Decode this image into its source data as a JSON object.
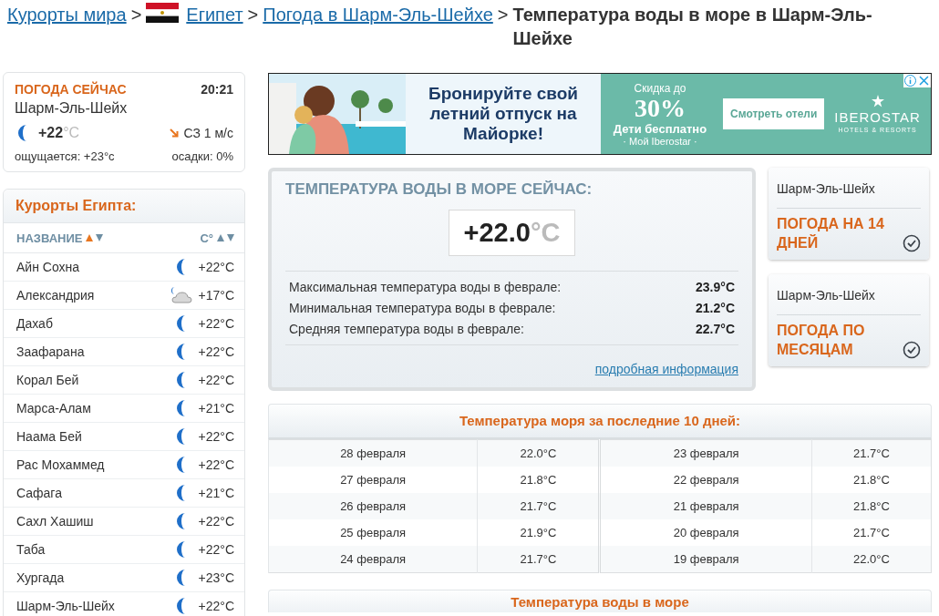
{
  "breadcrumb": [
    {
      "kind": "link",
      "text": "Курорты мира"
    },
    {
      "kind": "sep",
      "text": ">"
    },
    {
      "kind": "flag"
    },
    {
      "kind": "link",
      "text": "Египет"
    },
    {
      "kind": "sep",
      "text": ">"
    },
    {
      "kind": "link",
      "text": "Погода в Шарм-Эль-Шейхе"
    },
    {
      "kind": "sep",
      "text": ">"
    },
    {
      "kind": "current",
      "text": "Температура воды в море в Шарм-Эль-Шейхе"
    }
  ],
  "now": {
    "title": "ПОГОДА СЕЙЧАС",
    "time": "20:21",
    "city": "Шарм-Эль-Шейх",
    "temp": "+22",
    "unit": "°C",
    "wind": "СЗ 1 м/с",
    "feels": "ощущается: +23°с",
    "precip": "осадки: 0%"
  },
  "resorts": {
    "title": "Курорты Египта:",
    "columns": [
      {
        "label": "НАЗВАНИЕ",
        "selected": true
      },
      {
        "label": "C°",
        "selected": false
      }
    ],
    "rows": [
      {
        "name": "Айн Сохна",
        "kind": "moon",
        "temp": "+22°C"
      },
      {
        "name": "Александрия",
        "kind": "cloud-moon",
        "temp": "+17°C"
      },
      {
        "name": "Дахаб",
        "kind": "moon",
        "temp": "+22°C"
      },
      {
        "name": "Заафарана",
        "kind": "moon",
        "temp": "+22°C"
      },
      {
        "name": "Корал Бей",
        "kind": "moon",
        "temp": "+22°C"
      },
      {
        "name": "Марса-Алам",
        "kind": "moon",
        "temp": "+21°C"
      },
      {
        "name": "Наама Бей",
        "kind": "moon",
        "temp": "+22°C"
      },
      {
        "name": "Рас Мохаммед",
        "kind": "moon",
        "temp": "+22°C"
      },
      {
        "name": "Сафага",
        "kind": "moon",
        "temp": "+21°C"
      },
      {
        "name": "Сахл Хашиш",
        "kind": "moon",
        "temp": "+22°C"
      },
      {
        "name": "Таба",
        "kind": "moon",
        "temp": "+22°C"
      },
      {
        "name": "Хургада",
        "kind": "moon",
        "temp": "+23°C"
      },
      {
        "name": "Шарм-Эль-Шейх",
        "kind": "moon",
        "temp": "+22°C"
      }
    ]
  },
  "ad": {
    "headline": "Бронируйте свой летний отпуск на Майорке!",
    "discount_label": "Скидка до",
    "discount": "30%",
    "kids": "Дети бесплатно",
    "club": "· Мой Iberostar ·",
    "button": "Смотреть отели",
    "brand": "IBEROSTAR",
    "brand_sub": "HOTELS & RESORTS"
  },
  "water": {
    "title": "ТЕМПЕРАТУРА ВОДЫ В МОРЕ СЕЙЧАС:",
    "value": "+22.0",
    "unit": "°C",
    "stats": [
      {
        "label": "Максимальная температура воды в феврале:",
        "value": "23.9°C"
      },
      {
        "label": "Минимальная температура воды в феврале:",
        "value": "21.2°C"
      },
      {
        "label": "Средняя температура воды в феврале:",
        "value": "22.7°C"
      }
    ],
    "link": "подробная информация"
  },
  "side_links": [
    {
      "city": "Шарм-Эль-Шейх",
      "title": "ПОГОДА НА 14 ДНЕЙ"
    },
    {
      "city": "Шарм-Эль-Шейх",
      "title": "ПОГОДА ПО МЕСЯЦАМ"
    }
  ],
  "history": {
    "title": "Температура моря за последние 10 дней:",
    "rows": [
      [
        "28 февраля",
        "22.0°C",
        "23 февраля",
        "21.7°C"
      ],
      [
        "27 февраля",
        "21.8°C",
        "22 февраля",
        "21.8°C"
      ],
      [
        "26 февраля",
        "21.7°C",
        "21 февраля",
        "21.8°C"
      ],
      [
        "25 февраля",
        "21.9°C",
        "20 февраля",
        "21.7°C"
      ],
      [
        "24 февраля",
        "21.7°C",
        "19 февраля",
        "22.0°C"
      ]
    ]
  },
  "next_section": {
    "title": "Температура воды в море"
  }
}
